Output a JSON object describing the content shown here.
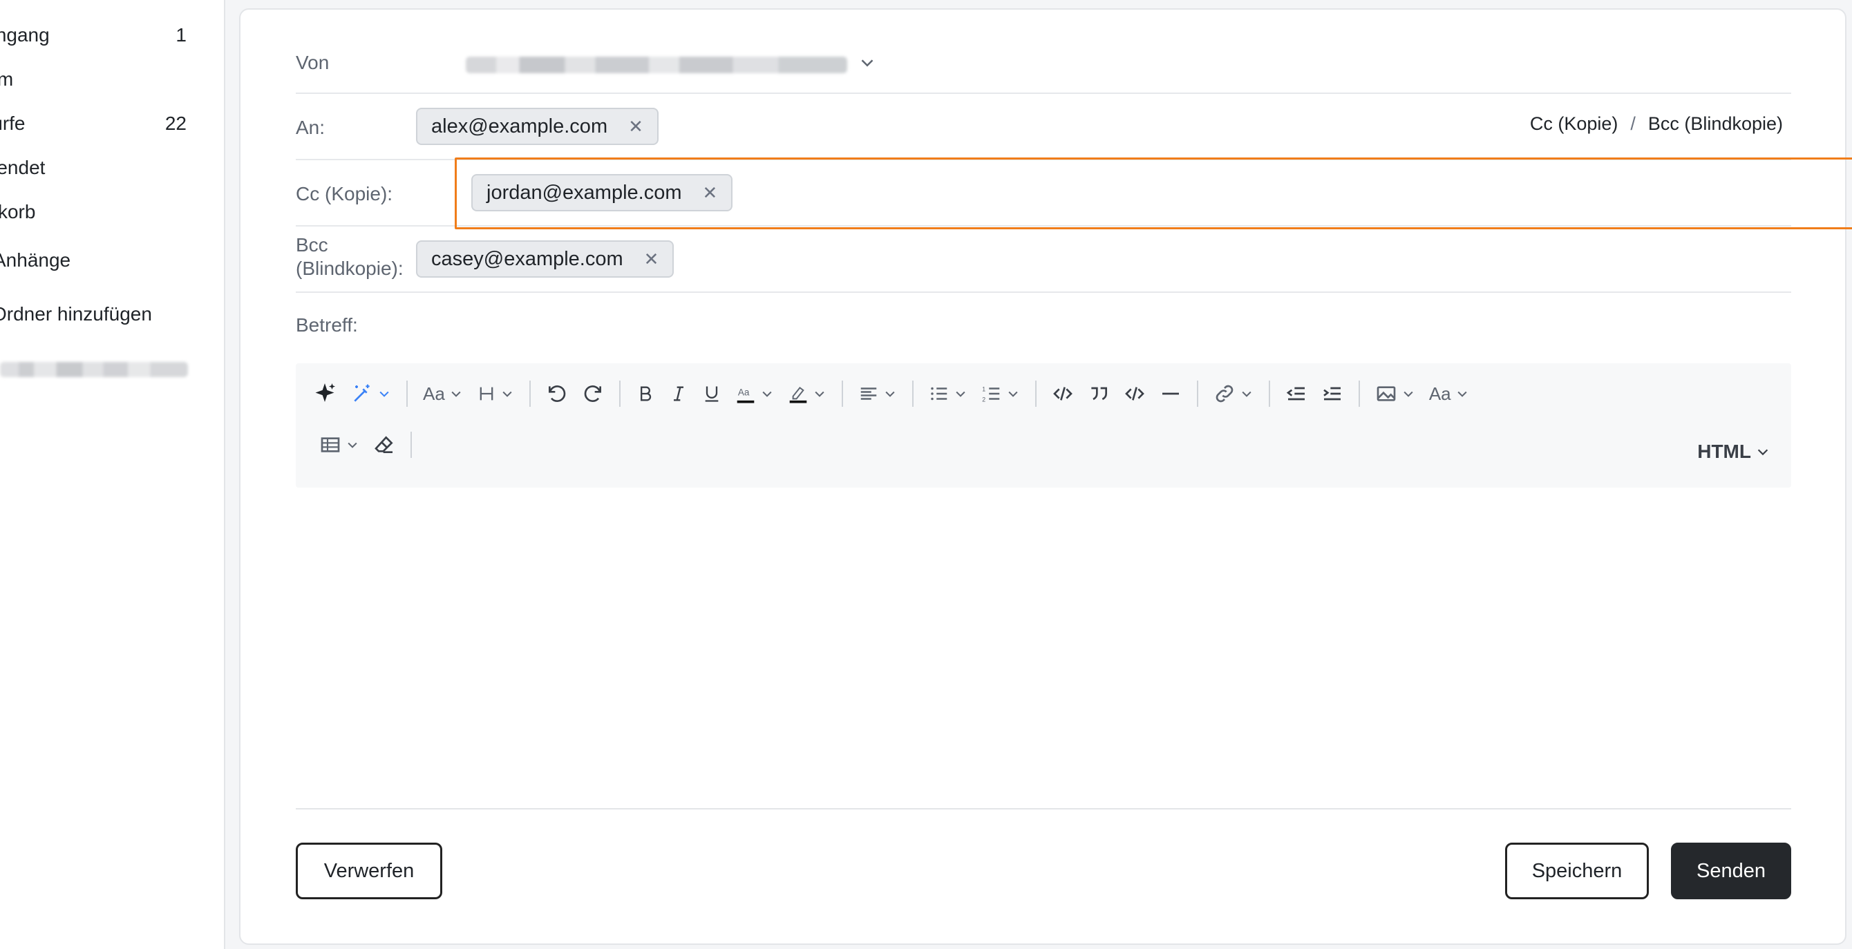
{
  "sidebar": {
    "items": [
      {
        "label": "Posteingang",
        "count": "1"
      },
      {
        "label": "Spam",
        "count": ""
      },
      {
        "label": "Entwürfe",
        "count": "22"
      },
      {
        "label": "Gesendet",
        "count": ""
      },
      {
        "label": "Papierkorb",
        "count": ""
      },
      {
        "label": "Anhänge",
        "count": ""
      },
      {
        "label": "Ordner hinzufügen",
        "count": ""
      }
    ]
  },
  "compose": {
    "from_label": "Von",
    "to_label": "An:",
    "to_recipients": [
      "alex@example.com"
    ],
    "cc_link": "Cc (Kopie)",
    "bcc_link": "Bcc (Blindkopie)",
    "link_separator": "/",
    "cc_label": "Cc (Kopie):",
    "cc_recipients": [
      "jordan@example.com"
    ],
    "bcc_label_line1": "Bcc",
    "bcc_label_line2": "(Blindkopie):",
    "bcc_recipients": [
      "casey@example.com"
    ],
    "subject_label": "Betreff:",
    "subject_value": ""
  },
  "toolbar": {
    "mode_label": "HTML"
  },
  "actions": {
    "discard": "Verwerfen",
    "save": "Speichern",
    "send": "Senden"
  },
  "colors": {
    "highlight": "#f07d1a",
    "send_bg": "#25282c",
    "ai_icon": "#3b82f6"
  }
}
